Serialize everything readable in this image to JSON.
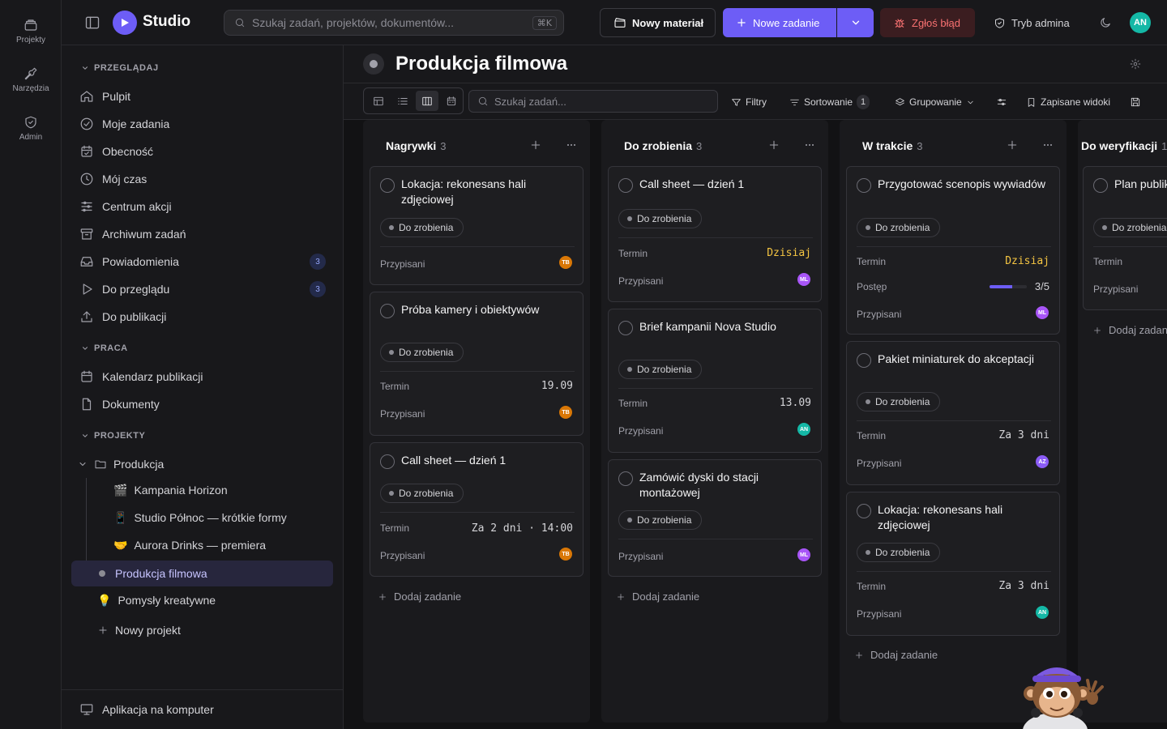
{
  "rail": [
    {
      "label": "Projekty",
      "icon": "projects-icon"
    },
    {
      "label": "Narzędzia",
      "icon": "tools-icon"
    },
    {
      "label": "Admin",
      "icon": "shield-icon"
    }
  ],
  "header": {
    "brand": "Studio",
    "search_placeholder": "Szukaj zadań, projektów, dokumentów...",
    "search_shortcut": "⌘K",
    "new_material": "Nowy materiał",
    "new_task": "Nowe zadanie",
    "report_bug": "Zgłoś błąd",
    "admin_mode": "Tryb admina",
    "user_initials": "AN"
  },
  "sidebar": {
    "browse_title": "PRZEGLĄDAJ",
    "browse": [
      {
        "label": "Pulpit",
        "icon": "home-icon"
      },
      {
        "label": "Moje zadania",
        "icon": "check-circle-icon"
      },
      {
        "label": "Obecność",
        "icon": "calendar-check-icon"
      },
      {
        "label": "Mój czas",
        "icon": "clock-icon"
      },
      {
        "label": "Centrum akcji",
        "icon": "sliders-icon"
      },
      {
        "label": "Archiwum zadań",
        "icon": "archive-icon"
      },
      {
        "label": "Powiadomienia",
        "icon": "inbox-icon",
        "count": "3"
      },
      {
        "label": "Do przeglądu",
        "icon": "play-icon",
        "count": "3"
      },
      {
        "label": "Do publikacji",
        "icon": "upload-icon"
      }
    ],
    "work_title": "PRACA",
    "work": [
      {
        "label": "Kalendarz publikacji",
        "icon": "calendar-icon"
      },
      {
        "label": "Dokumenty",
        "icon": "file-icon"
      }
    ],
    "projects_title": "PROJEKTY",
    "projects": {
      "group": "Produkcja",
      "children": [
        {
          "emoji": "🎬",
          "label": "Kampania Horizon"
        },
        {
          "emoji": "📱",
          "label": "Studio Północ — krótkie formy"
        },
        {
          "emoji": "🤝",
          "label": "Aurora Drinks — premiera"
        },
        {
          "emoji": "",
          "label": "Produkcja filmowa"
        }
      ],
      "ideas": {
        "emoji": "💡",
        "label": "Pomysły kreatywne"
      },
      "new_project": "Nowy projekt"
    },
    "desktop_app": "Aplikacja na komputer"
  },
  "main": {
    "title": "Produkcja filmowa",
    "task_search_placeholder": "Szukaj zadań...",
    "filters": "Filtry",
    "sort": "Sortowanie",
    "sort_count": "1",
    "grouping": "Grupowanie",
    "saved_views": "Zapisane widoki"
  },
  "board": {
    "columns": [
      {
        "title": "Nagrywki",
        "count": "3",
        "add_label": "Dodaj zadanie",
        "cards": [
          {
            "title": "Lokacja: rekonesans hali zdjęciowej",
            "status": "Do zrobienia",
            "assigned_label": "Przypisani",
            "assignee": "TB"
          },
          {
            "title": "Próba kamery i obiektywów",
            "status": "Do zrobienia",
            "due_label": "Termin",
            "due": "19.09",
            "assigned_label": "Przypisani",
            "assignee": "TB"
          },
          {
            "title": "Call sheet — dzień 1",
            "status": "Do zrobienia",
            "due_label": "Termin",
            "due": "Za 2 dni · 14:00",
            "assigned_label": "Przypisani",
            "assignee": "TB"
          }
        ]
      },
      {
        "title": "Do zrobienia",
        "count": "3",
        "add_label": "Dodaj zadanie",
        "cards": [
          {
            "title": "Call sheet — dzień 1",
            "status": "Do zrobienia",
            "due_label": "Termin",
            "due": "Dzisiaj",
            "assigned_label": "Przypisani",
            "assignee": "ML"
          },
          {
            "title": "Brief kampanii Nova Studio",
            "status": "Do zrobienia",
            "due_label": "Termin",
            "due": "13.09",
            "assigned_label": "Przypisani",
            "assignee": "AN"
          },
          {
            "title": "Zamówić dyski do stacji montażowej",
            "status": "Do zrobienia",
            "assigned_label": "Przypisani",
            "assignee": "ML"
          }
        ]
      },
      {
        "title": "W trakcie",
        "count": "3",
        "add_label": "Dodaj zadanie",
        "cards": [
          {
            "title": "Przygotować scenopis wywiadów",
            "status": "Do zrobienia",
            "due_label": "Termin",
            "due": "Dzisiaj",
            "progress_label": "Postęp",
            "progress": "3/5",
            "progress_value": 0.6,
            "assigned_label": "Przypisani",
            "assignee": "ML"
          },
          {
            "title": "Pakiet miniaturek do akceptacji",
            "status": "Do zrobienia",
            "due_label": "Termin",
            "due": "Za 3 dni",
            "assigned_label": "Przypisani",
            "assignee": "AZ"
          },
          {
            "title": "Lokacja: rekonesans hali zdjęciowej",
            "status": "Do zrobienia",
            "due_label": "Termin",
            "due": "Za 3 dni",
            "assigned_label": "Przypisani",
            "assignee": "AN"
          }
        ]
      },
      {
        "title": "Do weryfikacji",
        "count": "1",
        "add_label": "Dodaj zadanie",
        "cards": [
          {
            "title": "Plan publikacji materiałów",
            "status": "Do zrobienia",
            "due_label": "Termin",
            "assigned_label": "Przypisani"
          }
        ]
      }
    ]
  },
  "colors": {
    "accent": "#6d5df6",
    "today": "#f5c542",
    "danger": "#f87171"
  }
}
